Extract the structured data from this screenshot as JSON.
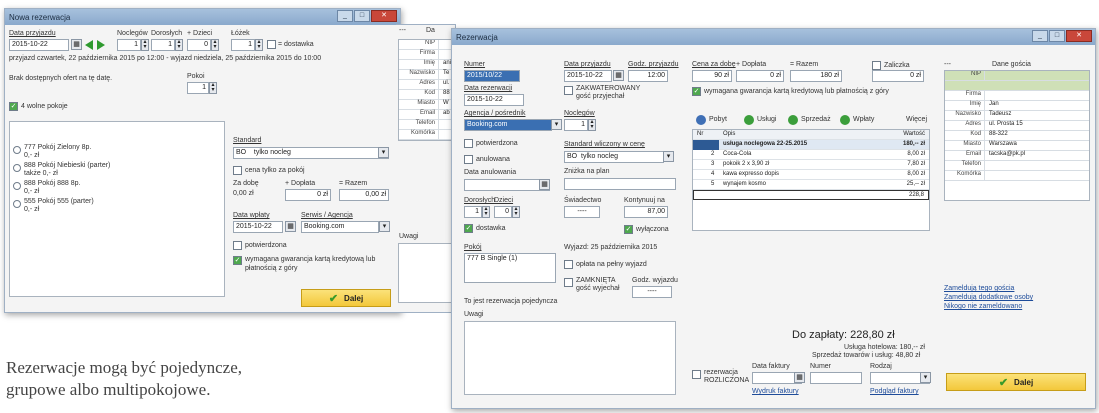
{
  "caption": {
    "line1": "Rezerwacje mogą być pojedyncze,",
    "line2": "grupowe albo multipokojowe."
  },
  "win1": {
    "title": "Nowa rezerwacja",
    "date_label": "Data przyjazdu",
    "date_value": "2015-10-22",
    "nights_label": "Noclegów",
    "nights_value": "1",
    "adults_label": "Dorosłych",
    "adults_value": "1",
    "children_label": "+ Dzieci",
    "children_value": "0",
    "rooms_label": "Łóżek",
    "rooms_value": "1",
    "children_check_label": "= dostawka",
    "stay_info": "przyjazd czwartek, 22 października 2015 po 12:00 - wyjazd niedziela, 25 października 2015 do 10:00",
    "show_free_label": "Brak dostępnych ofert na tę datę.",
    "room_label": "Pokoi",
    "room_value": "1",
    "free_check_label": "4 wolne pokoje",
    "rooms_list": [
      {
        "name": "777 Pokój Zielony 8p.",
        "price": "0,- zł"
      },
      {
        "name": "888 Pokój Niebieski (parter)",
        "price": "także 0,- zł"
      },
      {
        "name": "888 Pokój 888 8p.",
        "price": "0,- zł"
      },
      {
        "name": "555 Pokój 555 (parter)",
        "price": "0,- zł"
      }
    ],
    "standard_label": "Standard",
    "standard_value": "BO",
    "standard_option": "tylko nocleg",
    "price_to_label": "cena tylko za pokój",
    "price_day_label": "Za dobę",
    "price_day_value": "0,00 zł",
    "surcharge_label": "+ Dopłata",
    "surcharge_value": "0 zł",
    "total_label": "= Razem",
    "total_value": "0,00 zł",
    "payment_date_label": "Data wpłaty",
    "payment_date_value": "2015-10-22",
    "service_label": "Serwis / Agencja",
    "service_value": "Booking.com",
    "deposit_label": "potwierdzona",
    "card_label": "wymagana gwarancja kartą kredytową lub płatnością z góry",
    "props_header": "Da",
    "props_keys": [
      "NIP",
      "Firma",
      "Imię",
      "Nazwisko",
      "Adres",
      "Kod",
      "Miasto",
      "Email",
      "Telefon",
      "Komórka"
    ],
    "props_vals": [
      "",
      "",
      "ani",
      "Te",
      "ul.",
      "88",
      "W",
      "ab",
      "",
      ""
    ],
    "notes_label": "Uwagi",
    "go_label": "Dalej"
  },
  "win2": {
    "title": "Rezerwacja",
    "number_label": "Numer",
    "number_value": "2015/10/22",
    "date_label": "Data przyjazdu",
    "date_value": "2015-10-22",
    "hour_label": "Godz. przyjazdu",
    "hour_value": "12:00",
    "res_date_label": "Data rezerwacji",
    "res_date_value": "2015-10-22",
    "paid_label": "ZAKWATEROWANY",
    "guest_label": "gość przyjechał",
    "nights_label": "Noclegów",
    "nights_value": "1",
    "agency_label": "Agencja / pośrednik",
    "agency_value": "Booking.com",
    "confirmed_label": "potwierdzona",
    "anulowana_label": "anulowana",
    "cancel_date_label": "Data anulowania",
    "standard_label": "Standard wliczony w cenę",
    "standard_value": "BO",
    "standard_option": "tylko nocleg",
    "discount_label": "Zniżka na plan",
    "adults_label": "Dorosłych",
    "adults_value": "1",
    "children_label": "Dzieci",
    "children_value": "0",
    "extra_bed_label": "dostawka",
    "invoice_label": "Świadectwo",
    "invoice_value": "----",
    "price_label": "Kontynuuj na",
    "price_value": "87,00",
    "payment_label": "wyłączona",
    "room_label": "Pokój",
    "room_value": "777 B Single (1)",
    "departure_info": "Wyjazd: 25 października 2015",
    "next_guest_label": "opłata na pełny wyjazd",
    "extra_time_label": "ZAMKNIĘTA",
    "extra_guest_label": "gość wyjechał",
    "extra_hour_label": "Godz. wyjazdu",
    "extra_hour_value": "----",
    "multi_label": "To jest rezerwacja pojedyncza",
    "notes_label": "Uwagi",
    "price_day_label": "Cena za dobę",
    "price_day_value": "90 zł",
    "surcharge_label": "+ Dopłata",
    "surcharge_value": "0 zł",
    "total_label": "= Razem",
    "total_value": "180 zł",
    "reserved_label": "Zaliczka",
    "reserved_value": "0 zł",
    "card_label": "wymagana gwarancja kartą kredytową lub płatnością z góry",
    "tabs": [
      "Pobyt",
      "Usługi",
      "Sprzedaż",
      "Wpłaty"
    ],
    "more_label": "Więcej",
    "table_header": [
      "Nr",
      "Opis",
      "Wartość"
    ],
    "rows": [
      {
        "nr": "1",
        "desc": "usługa noclegowa 22-25.2015",
        "val": "180,-- zł"
      },
      {
        "nr": "2",
        "desc": "Coca-Cola",
        "val": "8,00 zł"
      },
      {
        "nr": "3",
        "desc": "pokoik 2 x 3,90 zł",
        "val": "7,80 zł"
      },
      {
        "nr": "4",
        "desc": "kawa expresso dopis",
        "val": "8,00 zł"
      },
      {
        "nr": "5",
        "desc": "wynajem kosmo",
        "val": "25,-- zł"
      }
    ],
    "table_total": "228,8",
    "props_header": "Dane gościa",
    "props_keys": [
      "NIP",
      "Firma",
      "Imię",
      "Nazwisko",
      "Adres",
      "Kod",
      "Miasto",
      "Email",
      "Telefon",
      "Komórka"
    ],
    "props_vals": [
      "",
      "",
      "Jan",
      "Tadeusz",
      "ul. Prosta 15",
      "88-322",
      "Warszawa",
      "tacska@pk.pl",
      "",
      ""
    ],
    "to_pay_label": "Do zapłaty:",
    "to_pay_value": "228,80 zł",
    "service_fee": "Usługa hotelowa: 180,-- zł",
    "sales_fee": "Sprzedaż towarów i usług: 48,80 zł",
    "invoice_date_label": "Data faktury",
    "invoice_no_label": "Numer",
    "invoice_type_label": "Rodzaj",
    "reservation_check_label": "rezerwacja ROZLICZONA",
    "print_invoice": "Wydruk faktury",
    "print_receipt": "Podgląd faktury",
    "links": [
      "Zameldują tego gościa",
      "Zameldują dodatkowe osoby",
      "Nikogo nie zameldowano"
    ],
    "go_label": "Dalej"
  }
}
